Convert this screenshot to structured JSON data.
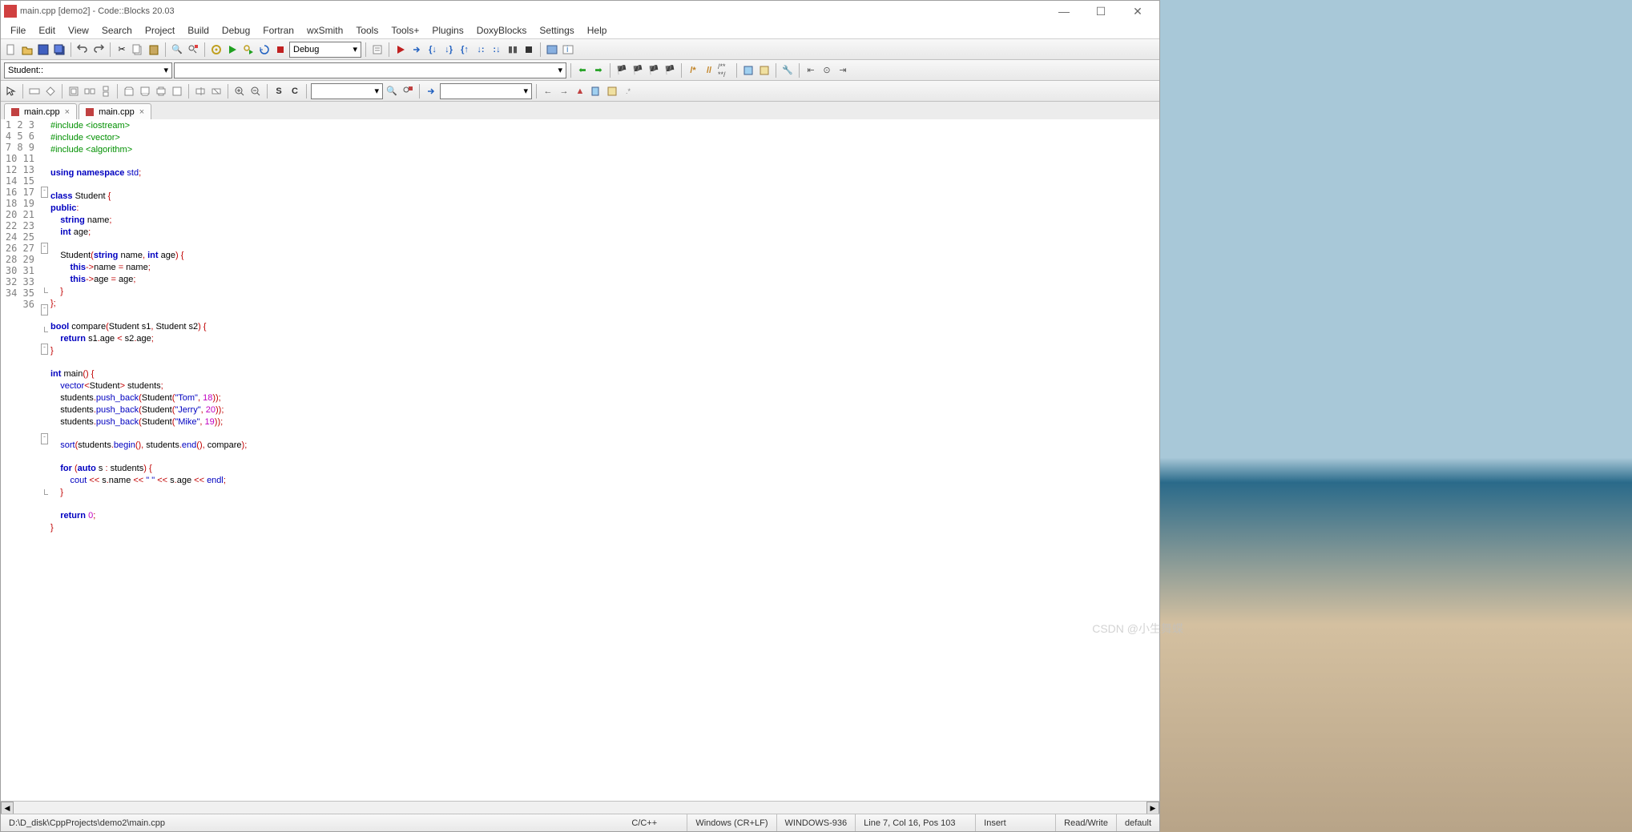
{
  "title": "main.cpp [demo2] - Code::Blocks 20.03",
  "menus": [
    "File",
    "Edit",
    "View",
    "Search",
    "Project",
    "Build",
    "Debug",
    "Fortran",
    "wxSmith",
    "Tools",
    "Tools+",
    "Plugins",
    "DoxyBlocks",
    "Settings",
    "Help"
  ],
  "build_target": "Debug",
  "symbol_dropdown": "Student::",
  "tabs": [
    "main.cpp",
    "main.cpp"
  ],
  "line_count": 36,
  "fold_marks": {
    "7": "⊟",
    "12": "⊟",
    "16": "└",
    "18": "⊟",
    "20": "└",
    "22": "⊟",
    "30": "⊟",
    "35": "└"
  },
  "code_lines": [
    [
      {
        "c": "kw-g",
        "t": "#include <iostream>"
      }
    ],
    [
      {
        "c": "kw-g",
        "t": "#include <vector>"
      }
    ],
    [
      {
        "c": "kw-g",
        "t": "#include <algorithm>"
      }
    ],
    [],
    [
      {
        "c": "kw-b",
        "t": "using"
      },
      {
        "c": "ident",
        "t": " "
      },
      {
        "c": "kw-b",
        "t": "namespace"
      },
      {
        "c": "ident",
        "t": " "
      },
      {
        "c": "kw-bl",
        "t": "std"
      },
      {
        "c": "punc",
        "t": ";"
      }
    ],
    [],
    [
      {
        "c": "kw-b",
        "t": "class"
      },
      {
        "c": "ident",
        "t": " Student "
      },
      {
        "c": "punc",
        "t": "{"
      }
    ],
    [
      {
        "c": "kw-b",
        "t": "public"
      },
      {
        "c": "punc",
        "t": ":"
      }
    ],
    [
      {
        "c": "ident",
        "t": "    "
      },
      {
        "c": "kw-b",
        "t": "string"
      },
      {
        "c": "ident",
        "t": " name"
      },
      {
        "c": "punc",
        "t": ";"
      }
    ],
    [
      {
        "c": "ident",
        "t": "    "
      },
      {
        "c": "kw-b",
        "t": "int"
      },
      {
        "c": "ident",
        "t": " age"
      },
      {
        "c": "punc",
        "t": ";"
      }
    ],
    [],
    [
      {
        "c": "ident",
        "t": "    Student"
      },
      {
        "c": "punc",
        "t": "("
      },
      {
        "c": "kw-b",
        "t": "string"
      },
      {
        "c": "ident",
        "t": " name"
      },
      {
        "c": "punc",
        "t": ","
      },
      {
        "c": "ident",
        "t": " "
      },
      {
        "c": "kw-b",
        "t": "int"
      },
      {
        "c": "ident",
        "t": " age"
      },
      {
        "c": "punc",
        "t": ")"
      },
      {
        "c": "ident",
        "t": " "
      },
      {
        "c": "punc",
        "t": "{"
      }
    ],
    [
      {
        "c": "ident",
        "t": "        "
      },
      {
        "c": "kw-b",
        "t": "this"
      },
      {
        "c": "punc",
        "t": "->"
      },
      {
        "c": "ident",
        "t": "name "
      },
      {
        "c": "punc",
        "t": "="
      },
      {
        "c": "ident",
        "t": " name"
      },
      {
        "c": "punc",
        "t": ";"
      }
    ],
    [
      {
        "c": "ident",
        "t": "        "
      },
      {
        "c": "kw-b",
        "t": "this"
      },
      {
        "c": "punc",
        "t": "->"
      },
      {
        "c": "ident",
        "t": "age "
      },
      {
        "c": "punc",
        "t": "="
      },
      {
        "c": "ident",
        "t": " age"
      },
      {
        "c": "punc",
        "t": ";"
      }
    ],
    [
      {
        "c": "ident",
        "t": "    "
      },
      {
        "c": "punc",
        "t": "}"
      }
    ],
    [
      {
        "c": "punc",
        "t": "};"
      }
    ],
    [],
    [
      {
        "c": "kw-b",
        "t": "bool"
      },
      {
        "c": "ident",
        "t": " compare"
      },
      {
        "c": "punc",
        "t": "("
      },
      {
        "c": "ident",
        "t": "Student s1"
      },
      {
        "c": "punc",
        "t": ","
      },
      {
        "c": "ident",
        "t": " Student s2"
      },
      {
        "c": "punc",
        "t": ")"
      },
      {
        "c": "ident",
        "t": " "
      },
      {
        "c": "punc",
        "t": "{"
      }
    ],
    [
      {
        "c": "ident",
        "t": "    "
      },
      {
        "c": "kw-b",
        "t": "return"
      },
      {
        "c": "ident",
        "t": " s1"
      },
      {
        "c": "punc",
        "t": "."
      },
      {
        "c": "ident",
        "t": "age "
      },
      {
        "c": "punc",
        "t": "<"
      },
      {
        "c": "ident",
        "t": " s2"
      },
      {
        "c": "punc",
        "t": "."
      },
      {
        "c": "ident",
        "t": "age"
      },
      {
        "c": "punc",
        "t": ";"
      }
    ],
    [
      {
        "c": "punc",
        "t": "}"
      }
    ],
    [],
    [
      {
        "c": "kw-b",
        "t": "int"
      },
      {
        "c": "ident",
        "t": " main"
      },
      {
        "c": "punc",
        "t": "()"
      },
      {
        "c": "ident",
        "t": " "
      },
      {
        "c": "punc",
        "t": "{"
      }
    ],
    [
      {
        "c": "ident",
        "t": "    "
      },
      {
        "c": "kw-bl",
        "t": "vector"
      },
      {
        "c": "punc",
        "t": "<"
      },
      {
        "c": "ident",
        "t": "Student"
      },
      {
        "c": "punc",
        "t": ">"
      },
      {
        "c": "ident",
        "t": " students"
      },
      {
        "c": "punc",
        "t": ";"
      }
    ],
    [
      {
        "c": "ident",
        "t": "    students"
      },
      {
        "c": "punc",
        "t": "."
      },
      {
        "c": "kw-bl",
        "t": "push_back"
      },
      {
        "c": "punc",
        "t": "("
      },
      {
        "c": "ident",
        "t": "Student"
      },
      {
        "c": "punc",
        "t": "("
      },
      {
        "c": "str",
        "t": "\"Tom\""
      },
      {
        "c": "punc",
        "t": ","
      },
      {
        "c": "ident",
        "t": " "
      },
      {
        "c": "num",
        "t": "18"
      },
      {
        "c": "punc",
        "t": "));"
      }
    ],
    [
      {
        "c": "ident",
        "t": "    students"
      },
      {
        "c": "punc",
        "t": "."
      },
      {
        "c": "kw-bl",
        "t": "push_back"
      },
      {
        "c": "punc",
        "t": "("
      },
      {
        "c": "ident",
        "t": "Student"
      },
      {
        "c": "punc",
        "t": "("
      },
      {
        "c": "str",
        "t": "\"Jerry\""
      },
      {
        "c": "punc",
        "t": ","
      },
      {
        "c": "ident",
        "t": " "
      },
      {
        "c": "num",
        "t": "20"
      },
      {
        "c": "punc",
        "t": "));"
      }
    ],
    [
      {
        "c": "ident",
        "t": "    students"
      },
      {
        "c": "punc",
        "t": "."
      },
      {
        "c": "kw-bl",
        "t": "push_back"
      },
      {
        "c": "punc",
        "t": "("
      },
      {
        "c": "ident",
        "t": "Student"
      },
      {
        "c": "punc",
        "t": "("
      },
      {
        "c": "str",
        "t": "\"Mike\""
      },
      {
        "c": "punc",
        "t": ","
      },
      {
        "c": "ident",
        "t": " "
      },
      {
        "c": "num",
        "t": "19"
      },
      {
        "c": "punc",
        "t": "));"
      }
    ],
    [],
    [
      {
        "c": "ident",
        "t": "    "
      },
      {
        "c": "kw-bl",
        "t": "sort"
      },
      {
        "c": "punc",
        "t": "("
      },
      {
        "c": "ident",
        "t": "students"
      },
      {
        "c": "punc",
        "t": "."
      },
      {
        "c": "kw-bl",
        "t": "begin"
      },
      {
        "c": "punc",
        "t": "(),"
      },
      {
        "c": "ident",
        "t": " students"
      },
      {
        "c": "punc",
        "t": "."
      },
      {
        "c": "kw-bl",
        "t": "end"
      },
      {
        "c": "punc",
        "t": "(),"
      },
      {
        "c": "ident",
        "t": " compare"
      },
      {
        "c": "punc",
        "t": ");"
      }
    ],
    [],
    [
      {
        "c": "ident",
        "t": "    "
      },
      {
        "c": "kw-b",
        "t": "for"
      },
      {
        "c": "ident",
        "t": " "
      },
      {
        "c": "punc",
        "t": "("
      },
      {
        "c": "kw-b",
        "t": "auto"
      },
      {
        "c": "ident",
        "t": " s "
      },
      {
        "c": "punc",
        "t": ":"
      },
      {
        "c": "ident",
        "t": " students"
      },
      {
        "c": "punc",
        "t": ")"
      },
      {
        "c": "ident",
        "t": " "
      },
      {
        "c": "punc",
        "t": "{"
      }
    ],
    [
      {
        "c": "ident",
        "t": "        "
      },
      {
        "c": "kw-bl",
        "t": "cout"
      },
      {
        "c": "ident",
        "t": " "
      },
      {
        "c": "punc",
        "t": "<<"
      },
      {
        "c": "ident",
        "t": " s"
      },
      {
        "c": "punc",
        "t": "."
      },
      {
        "c": "ident",
        "t": "name "
      },
      {
        "c": "punc",
        "t": "<<"
      },
      {
        "c": "ident",
        "t": " "
      },
      {
        "c": "str",
        "t": "\" \""
      },
      {
        "c": "ident",
        "t": " "
      },
      {
        "c": "punc",
        "t": "<<"
      },
      {
        "c": "ident",
        "t": " s"
      },
      {
        "c": "punc",
        "t": "."
      },
      {
        "c": "ident",
        "t": "age "
      },
      {
        "c": "punc",
        "t": "<<"
      },
      {
        "c": "ident",
        "t": " "
      },
      {
        "c": "kw-bl",
        "t": "endl"
      },
      {
        "c": "punc",
        "t": ";"
      }
    ],
    [
      {
        "c": "ident",
        "t": "    "
      },
      {
        "c": "punc",
        "t": "}"
      }
    ],
    [],
    [
      {
        "c": "ident",
        "t": "    "
      },
      {
        "c": "kw-b",
        "t": "return"
      },
      {
        "c": "ident",
        "t": " "
      },
      {
        "c": "num",
        "t": "0"
      },
      {
        "c": "punc",
        "t": ";"
      }
    ],
    [
      {
        "c": "punc",
        "t": "}"
      }
    ],
    []
  ],
  "status": {
    "path": "D:\\D_disk\\CppProjects\\demo2\\main.cpp",
    "lang": "C/C++",
    "eol": "Windows (CR+LF)",
    "enc": "WINDOWS-936",
    "pos": "Line 7, Col 16, Pos 103",
    "ins": "Insert",
    "rw": "Read/Write",
    "prof": "default"
  },
  "watermark": "CSDN @小生舞蝶"
}
